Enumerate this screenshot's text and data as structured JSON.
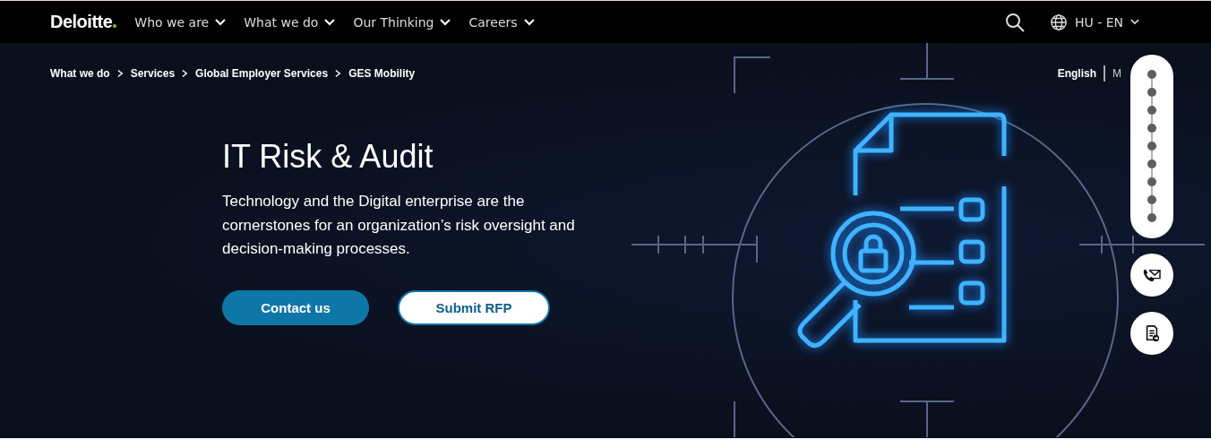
{
  "header": {
    "logo": "Deloitte",
    "nav": [
      {
        "label": "Who we are"
      },
      {
        "label": "What we do"
      },
      {
        "label": "Our Thinking"
      },
      {
        "label": "Careers"
      }
    ],
    "locale": "HU - EN"
  },
  "breadcrumbs": [
    {
      "label": "What we do"
    },
    {
      "label": "Services"
    },
    {
      "label": "Global Employer Services"
    },
    {
      "label": "GES Mobility"
    }
  ],
  "languages": [
    {
      "label": "English",
      "selected": true
    },
    {
      "label": "M",
      "selected": false
    }
  ],
  "hero": {
    "title": "IT Risk & Audit",
    "text": "Technology and the Digital enterprise are the cornerstones for an organization’s risk oversight and decision-making processes.",
    "buttons": [
      {
        "label": "Contact us",
        "kind": "primary"
      },
      {
        "label": "Submit RFP",
        "kind": "secondary"
      }
    ]
  }
}
